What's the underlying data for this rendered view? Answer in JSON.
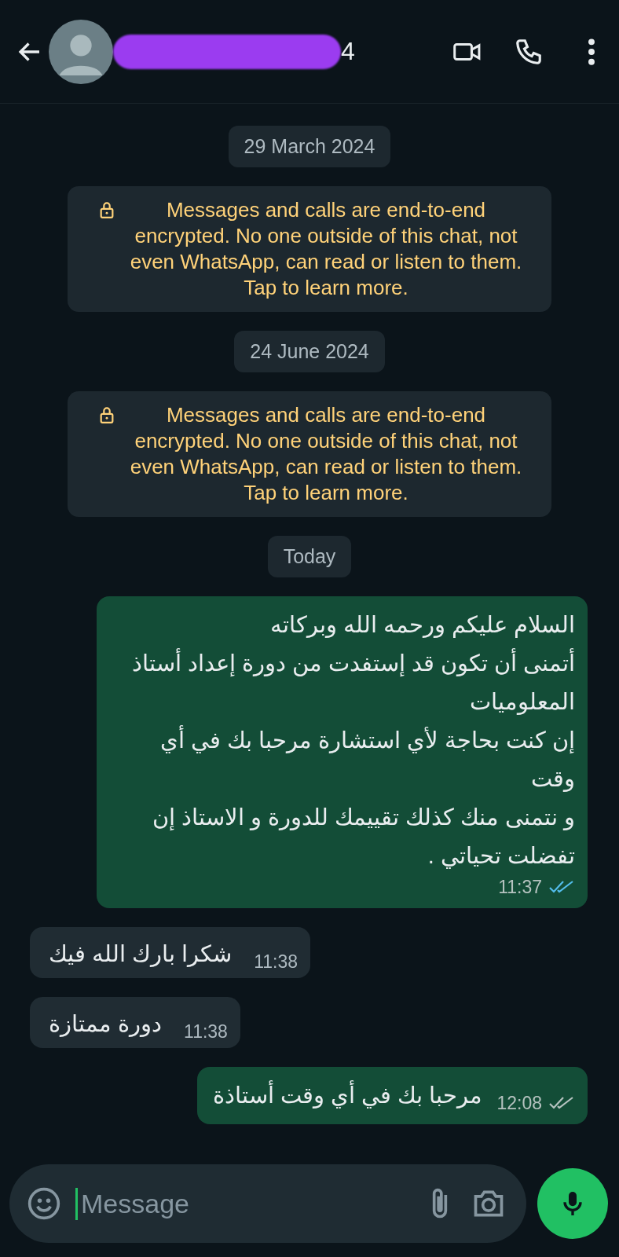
{
  "header": {
    "name_visible": "4",
    "redacted": true
  },
  "messages": [
    {
      "kind": "date",
      "text": "29 March 2024"
    },
    {
      "kind": "system",
      "text": "Messages and calls are end-to-end encrypted. No one outside of this chat, not even WhatsApp, can read or listen to them. Tap to learn more."
    },
    {
      "kind": "date",
      "text": "24 June 2024"
    },
    {
      "kind": "system",
      "text": "Messages and calls are end-to-end encrypted. No one outside of this chat, not even WhatsApp, can read or listen to them. Tap to learn more."
    },
    {
      "kind": "date",
      "text": "Today"
    },
    {
      "kind": "outgoing",
      "text": "السلام عليكم ورحمه الله وبركاته\nأتمنى أن تكون قد إستفدت من دورة إعداد أستاذ المعلوميات\nإن كنت بحاجة لأي استشارة مرحبا بك في أي وقت\nو نتمنى منك كذلك تقييمك للدورة و الاستاذ إن تفضلت تحياتي .",
      "time": "11:37",
      "read": true
    },
    {
      "kind": "incoming",
      "text": "شكرا بارك الله فيك",
      "time": "11:38"
    },
    {
      "kind": "incoming",
      "text": "دورة ممتازة",
      "time": "11:38"
    },
    {
      "kind": "outgoing",
      "text": "مرحبا بك في أي وقت أستاذة",
      "time": "12:08",
      "read": false
    }
  ],
  "composer": {
    "placeholder": "Message"
  }
}
